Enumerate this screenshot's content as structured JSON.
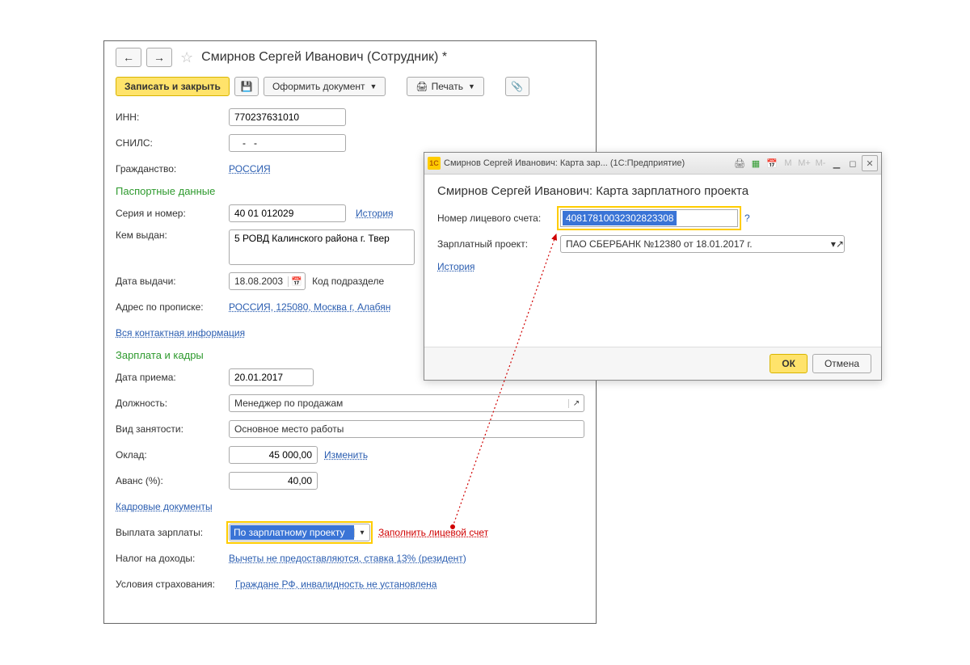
{
  "main": {
    "title": "Смирнов Сергей Иванович (Сотрудник) *",
    "toolbar": {
      "save_close": "Записать и закрыть",
      "doc": "Оформить документ",
      "print": "Печать"
    },
    "fields": {
      "inn_label": "ИНН:",
      "inn": "770237631010",
      "snils_label": "СНИЛС:",
      "snils": "   -   -",
      "citizenship_label": "Гражданство:",
      "citizenship": "РОССИЯ"
    },
    "passport": {
      "header": "Паспортные данные",
      "series_label": "Серия и номер:",
      "series": "40 01 012029",
      "history": "История",
      "issued_by_label": "Кем выдан:",
      "issued_by": "5 РОВД Калинского района г. Твер",
      "issued_date_label": "Дата выдачи:",
      "issued_date": "18.08.2003",
      "code_label": "Код подразделе",
      "address_label": "Адрес по прописке:",
      "address": "РОССИЯ, 125080, Москва г, Алабян",
      "all_contact": "Вся контактная информация"
    },
    "hr": {
      "header": "Зарплата и кадры",
      "hire_date_label": "Дата приема:",
      "hire_date": "20.01.2017",
      "position_label": "Должность:",
      "position": "Менеджер по продажам",
      "employment_label": "Вид занятости:",
      "employment": "Основное место работы",
      "salary_label": "Оклад:",
      "salary": "45 000,00",
      "change": "Изменить",
      "advance_label": "Аванс (%):",
      "advance": "40,00",
      "hr_docs": "Кадровые документы",
      "payout_label": "Выплата зарплаты:",
      "payout": "По зарплатному проекту",
      "fill_account": "Заполнить лицевой счет",
      "tax_label": "Налог на доходы:",
      "tax": "Вычеты не предоставляются, ставка 13% (резидент)",
      "insurance_label": "Условия страхования:",
      "insurance": "Граждане РФ, инвалидность не установлена"
    }
  },
  "dialog": {
    "titlebar": "Смирнов Сергей Иванович: Карта зар...   (1С:Предприятие)",
    "title": "Смирнов Сергей Иванович: Карта зарплатного проекта",
    "account_label": "Номер лицевого счета:",
    "account": "40817810032302823308",
    "project_label": "Зарплатный проект:",
    "project": "ПАО СБЕРБАНК №12380     от 18.01.2017 г.",
    "history": "История",
    "ok": "ОК",
    "cancel": "Отмена"
  }
}
